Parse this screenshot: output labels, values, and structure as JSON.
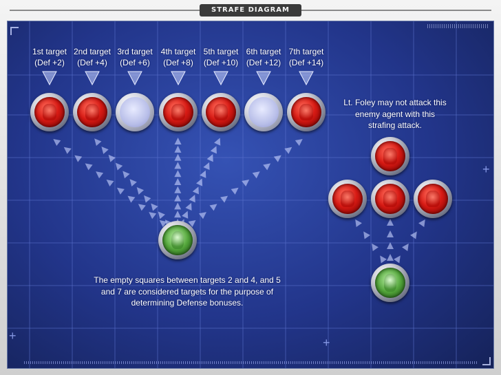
{
  "window": {
    "title": "STRAFE DIAGRAM"
  },
  "targets": [
    {
      "label": "1st target",
      "defense": "(Def +2)",
      "occupied": true
    },
    {
      "label": "2nd target",
      "defense": "(Def +4)",
      "occupied": true
    },
    {
      "label": "3rd target",
      "defense": "(Def +6)",
      "occupied": false
    },
    {
      "label": "4th target",
      "defense": "(Def +8)",
      "occupied": true
    },
    {
      "label": "5th target",
      "defense": "(Def +10)",
      "occupied": true
    },
    {
      "label": "6th target",
      "defense": "(Def +12)",
      "occupied": false
    },
    {
      "label": "7th target",
      "defense": "(Def +14)",
      "occupied": true
    }
  ],
  "notes": {
    "foley": "Lt. Foley may not attack this enemy agent with this strafing attack.",
    "empty_squares": "The empty squares between targets 2 and 4, and 5 and 7 are considered targets for the purpose of determining Defense bonuses."
  },
  "icons": {
    "enemy_token": "red-enemy-agent-icon",
    "hero_token": "green-hero-icon",
    "empty_square": "empty-square-icon",
    "target_marker": "down-triangle-icon"
  },
  "colors": {
    "board": "#22358a",
    "grid_line": "#5d74d0",
    "enemy": "#d71a14",
    "hero": "#52a43a",
    "arrow": "#c9d4ff"
  }
}
